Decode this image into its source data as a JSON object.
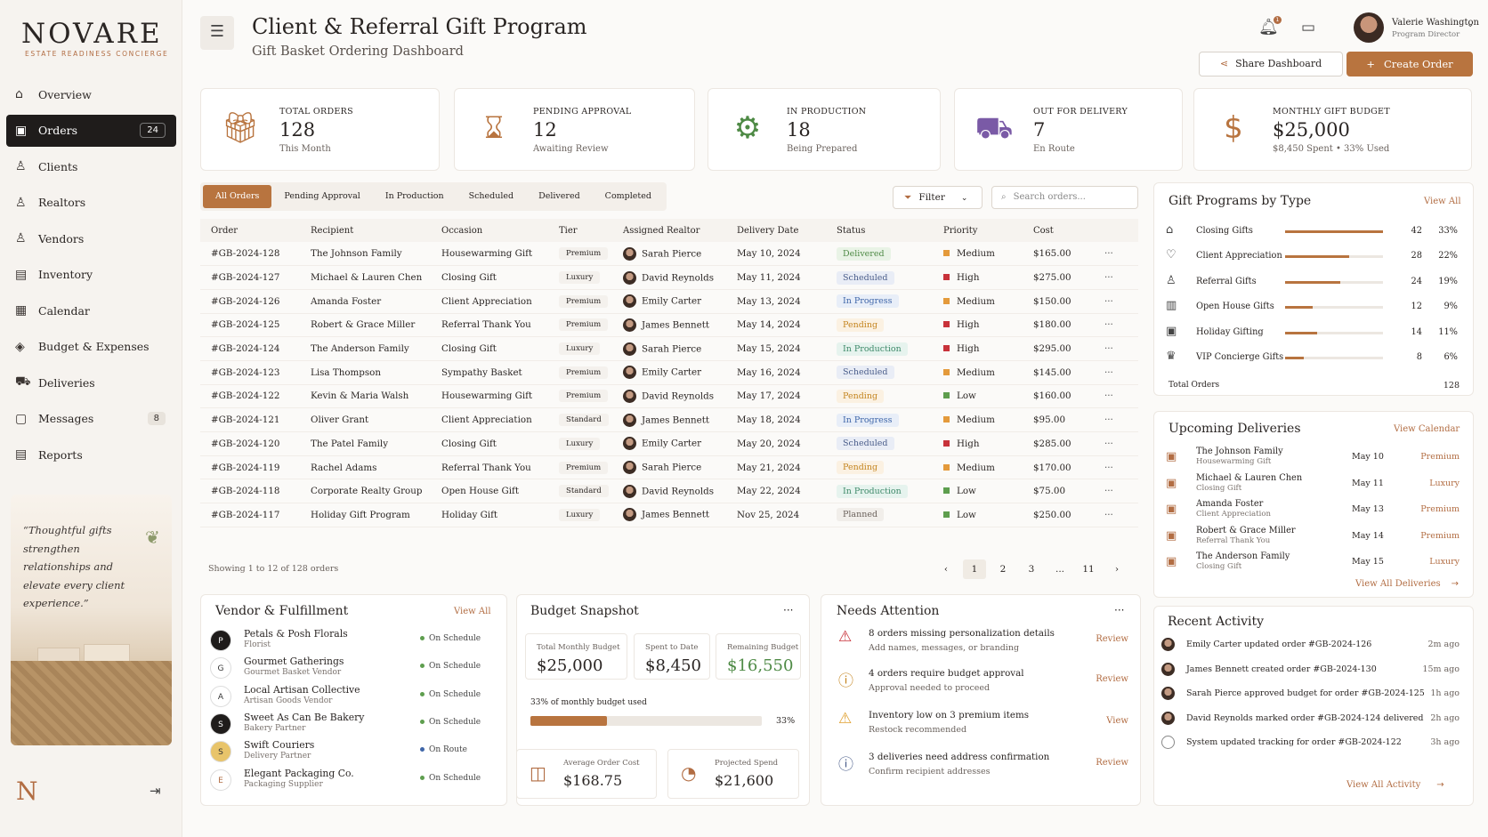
{
  "brand": {
    "logo": "NOVARE",
    "tagline": "ESTATE READINESS CONCIERGE",
    "mark": "N"
  },
  "nav": [
    {
      "label": "Overview",
      "icon": "home-icon",
      "glyph": "⌂"
    },
    {
      "label": "Orders",
      "icon": "gift-icon",
      "glyph": "▣",
      "badge": "24"
    },
    {
      "label": "Clients",
      "icon": "user-icon",
      "glyph": "♙"
    },
    {
      "label": "Realtors",
      "icon": "users-icon",
      "glyph": "♙"
    },
    {
      "label": "Vendors",
      "icon": "vendors-icon",
      "glyph": "♙"
    },
    {
      "label": "Inventory",
      "icon": "inventory-icon",
      "glyph": "▤"
    },
    {
      "label": "Calendar",
      "icon": "calendar-icon",
      "glyph": "▦"
    },
    {
      "label": "Budget & Expenses",
      "icon": "budget-icon",
      "glyph": "◈"
    },
    {
      "label": "Deliveries",
      "icon": "truck-icon",
      "glyph": "⛟"
    },
    {
      "label": "Messages",
      "icon": "message-icon",
      "glyph": "▢",
      "badge": "8"
    },
    {
      "label": "Reports",
      "icon": "report-icon",
      "glyph": "▤"
    }
  ],
  "quote": "“Thoughtful gifts strengthen relationships and elevate every client experience.”",
  "header": {
    "title": "Client & Referral Gift Program",
    "subtitle": "Gift Basket Ordering Dashboard",
    "notif_count": "1",
    "user_name": "Valerie Washington",
    "user_role": "Program Director",
    "share": "Share Dashboard",
    "create": "Create Order"
  },
  "stats": [
    {
      "label": "TOTAL ORDERS",
      "value": "128",
      "sub": "This Month",
      "icon": "gift-icon",
      "glyph": "🎁︎",
      "color": "#b8743f"
    },
    {
      "label": "PENDING APPROVAL",
      "value": "12",
      "sub": "Awaiting Review",
      "icon": "hourglass-icon",
      "glyph": "⌛︎",
      "color": "#b8743f"
    },
    {
      "label": "IN PRODUCTION",
      "value": "18",
      "sub": "Being Prepared",
      "icon": "gear-icon",
      "glyph": "⚙",
      "color": "#4e8a45"
    },
    {
      "label": "OUT FOR DELIVERY",
      "value": "7",
      "sub": "En Route",
      "icon": "truck-icon",
      "glyph": "⛟",
      "color": "#7a5aa6"
    },
    {
      "label": "MONTHLY GIFT BUDGET",
      "value": "$25,000",
      "sub": "$8,450 Spent • 33% Used",
      "icon": "dollar-icon",
      "glyph": "$",
      "color": "#b8743f"
    }
  ],
  "tabs": [
    "All Orders",
    "Pending Approval",
    "In Production",
    "Scheduled",
    "Delivered",
    "Completed"
  ],
  "filter": "Filter",
  "search_placeholder": "Search orders...",
  "columns": [
    "Order",
    "Recipient",
    "Occasion",
    "Tier",
    "Assigned Realtor",
    "Delivery Date",
    "Status",
    "Priority",
    "Cost"
  ],
  "orders": [
    {
      "id": "#GB-2024-128",
      "recipient": "The Johnson Family",
      "occasion": "Housewarming Gift",
      "tier": "Premium",
      "realtor": "Sarah Pierce",
      "date": "May 10, 2024",
      "status": "Delivered",
      "priority": "Medium",
      "cost": "$165.00"
    },
    {
      "id": "#GB-2024-127",
      "recipient": "Michael & Lauren Chen",
      "occasion": "Closing Gift",
      "tier": "Luxury",
      "realtor": "David Reynolds",
      "date": "May 11, 2024",
      "status": "Scheduled",
      "priority": "High",
      "cost": "$275.00"
    },
    {
      "id": "#GB-2024-126",
      "recipient": "Amanda Foster",
      "occasion": "Client Appreciation",
      "tier": "Premium",
      "realtor": "Emily Carter",
      "date": "May 13, 2024",
      "status": "In Progress",
      "priority": "Medium",
      "cost": "$150.00"
    },
    {
      "id": "#GB-2024-125",
      "recipient": "Robert & Grace Miller",
      "occasion": "Referral Thank You",
      "tier": "Premium",
      "realtor": "James Bennett",
      "date": "May 14, 2024",
      "status": "Pending",
      "priority": "High",
      "cost": "$180.00"
    },
    {
      "id": "#GB-2024-124",
      "recipient": "The Anderson Family",
      "occasion": "Closing Gift",
      "tier": "Luxury",
      "realtor": "Sarah Pierce",
      "date": "May 15, 2024",
      "status": "In Production",
      "priority": "High",
      "cost": "$295.00"
    },
    {
      "id": "#GB-2024-123",
      "recipient": "Lisa Thompson",
      "occasion": "Sympathy Basket",
      "tier": "Premium",
      "realtor": "Emily Carter",
      "date": "May 16, 2024",
      "status": "Scheduled",
      "priority": "Medium",
      "cost": "$145.00"
    },
    {
      "id": "#GB-2024-122",
      "recipient": "Kevin & Maria Walsh",
      "occasion": "Housewarming Gift",
      "tier": "Premium",
      "realtor": "David Reynolds",
      "date": "May 17, 2024",
      "status": "Pending",
      "priority": "Low",
      "cost": "$160.00"
    },
    {
      "id": "#GB-2024-121",
      "recipient": "Oliver Grant",
      "occasion": "Client Appreciation",
      "tier": "Standard",
      "realtor": "James Bennett",
      "date": "May 18, 2024",
      "status": "In Progress",
      "priority": "Medium",
      "cost": "$95.00"
    },
    {
      "id": "#GB-2024-120",
      "recipient": "The Patel Family",
      "occasion": "Closing Gift",
      "tier": "Luxury",
      "realtor": "Emily Carter",
      "date": "May 20, 2024",
      "status": "Scheduled",
      "priority": "High",
      "cost": "$285.00"
    },
    {
      "id": "#GB-2024-119",
      "recipient": "Rachel Adams",
      "occasion": "Referral Thank You",
      "tier": "Premium",
      "realtor": "Sarah Pierce",
      "date": "May 21, 2024",
      "status": "Pending",
      "priority": "Medium",
      "cost": "$170.00"
    },
    {
      "id": "#GB-2024-118",
      "recipient": "Corporate Realty Group",
      "occasion": "Open House Gift",
      "tier": "Standard",
      "realtor": "David Reynolds",
      "date": "May 22, 2024",
      "status": "In Production",
      "priority": "Low",
      "cost": "$75.00"
    },
    {
      "id": "#GB-2024-117",
      "recipient": "Holiday Gift Program",
      "occasion": "Holiday Gift",
      "tier": "Luxury",
      "realtor": "James Bennett",
      "date": "Nov 25, 2024",
      "status": "Planned",
      "priority": "Low",
      "cost": "$250.00"
    }
  ],
  "showing": "Showing 1 to 12 of 128 orders",
  "pager": [
    "‹",
    "1",
    "2",
    "3",
    "...",
    "11",
    "›"
  ],
  "gift_programs": {
    "title": "Gift Programs by Type",
    "link": "View All",
    "total_label": "Total Orders",
    "total": "128",
    "rows": [
      {
        "label": "Closing Gifts",
        "count": "42",
        "pct": "33%",
        "share": 1.0,
        "icon": "home-icon",
        "glyph": "⌂"
      },
      {
        "label": "Client Appreciation",
        "count": "28",
        "pct": "22%",
        "share": 0.65,
        "icon": "heart-icon",
        "glyph": "♡"
      },
      {
        "label": "Referral Gifts",
        "count": "24",
        "pct": "19%",
        "share": 0.56,
        "icon": "users-icon",
        "glyph": "♙"
      },
      {
        "label": "Open House Gifts",
        "count": "12",
        "pct": "9%",
        "share": 0.28,
        "icon": "building-icon",
        "glyph": "▥"
      },
      {
        "label": "Holiday Gifting",
        "count": "14",
        "pct": "11%",
        "share": 0.33,
        "icon": "gift-icon",
        "glyph": "▣"
      },
      {
        "label": "VIP Concierge Gifts",
        "count": "8",
        "pct": "6%",
        "share": 0.19,
        "icon": "crown-icon",
        "glyph": "♛"
      }
    ]
  },
  "upcoming": {
    "title": "Upcoming Deliveries",
    "link": "View Calendar",
    "footer": "View All Deliveries",
    "rows": [
      {
        "name": "The Johnson Family",
        "occasion": "Housewarming Gift",
        "date": "May 10",
        "tier": "Premium"
      },
      {
        "name": "Michael & Lauren Chen",
        "occasion": "Closing Gift",
        "date": "May 11",
        "tier": "Luxury"
      },
      {
        "name": "Amanda Foster",
        "occasion": "Client Appreciation",
        "date": "May 13",
        "tier": "Premium"
      },
      {
        "name": "Robert & Grace Miller",
        "occasion": "Referral Thank You",
        "date": "May 14",
        "tier": "Premium"
      },
      {
        "name": "The Anderson Family",
        "occasion": "Closing Gift",
        "date": "May 15",
        "tier": "Luxury"
      }
    ]
  },
  "vendors": {
    "title": "Vendor & Fulfillment",
    "link": "View All",
    "rows": [
      {
        "name": "Petals & Posh Florals",
        "type": "Florist",
        "status": "On Schedule",
        "dot": "#5e9e4e",
        "logo": "P",
        "logo_bg": "#1f1c1b",
        "logo_fg": "#fff"
      },
      {
        "name": "Gourmet Gatherings",
        "type": "Gourmet Basket Vendor",
        "status": "On Schedule",
        "dot": "#5e9e4e",
        "logo": "G",
        "logo_bg": "#fff",
        "logo_fg": "#333"
      },
      {
        "name": "Local Artisan Collective",
        "type": "Artisan Goods Vendor",
        "status": "On Schedule",
        "dot": "#5e9e4e",
        "logo": "A",
        "logo_bg": "#fff",
        "logo_fg": "#333"
      },
      {
        "name": "Sweet As Can Be Bakery",
        "type": "Bakery Partner",
        "status": "On Schedule",
        "dot": "#5e9e4e",
        "logo": "S",
        "logo_bg": "#1f1c1b",
        "logo_fg": "#fff"
      },
      {
        "name": "Swift Couriers",
        "type": "Delivery Partner",
        "status": "On Route",
        "dot": "#3f66a8",
        "logo": "S",
        "logo_bg": "#e8c46a",
        "logo_fg": "#333"
      },
      {
        "name": "Elegant Packaging Co.",
        "type": "Packaging Supplier",
        "status": "On Schedule",
        "dot": "#5e9e4e",
        "logo": "E",
        "logo_bg": "#fff",
        "logo_fg": "#b26d43"
      }
    ]
  },
  "budget": {
    "title": "Budget Snapshot",
    "total_label": "Total Monthly Budget",
    "total": "$25,000",
    "spent_label": "Spent to Date",
    "spent": "$8,450",
    "remaining_label": "Remaining Budget",
    "remaining": "$16,550",
    "used_text": "33% of monthly budget used",
    "used_pct": "33%",
    "used_frac": 0.33,
    "avg_label": "Average Order Cost",
    "avg": "$168.75",
    "proj_label": "Projected Spend",
    "proj": "$21,600",
    "remaining_color": "#4e8a45"
  },
  "attention": {
    "title": "Needs Attention",
    "rows": [
      {
        "title": "8 orders missing personalization details",
        "sub": "Add names, messages, or branding",
        "action": "Review",
        "icon": "warning-icon",
        "glyph": "⚠",
        "color": "#c8323a"
      },
      {
        "title": "4 orders require budget approval",
        "sub": "Approval needed to proceed",
        "action": "Review",
        "icon": "alert-icon",
        "glyph": "ⓘ",
        "color": "#c4841e"
      },
      {
        "title": "Inventory low on 3 premium items",
        "sub": "Restock recommended",
        "action": "View",
        "icon": "warning-icon",
        "glyph": "⚠",
        "color": "#e0a030"
      },
      {
        "title": "3 deliveries need address confirmation",
        "sub": "Confirm recipient addresses",
        "action": "Review",
        "icon": "info-icon",
        "glyph": "ⓘ",
        "color": "#4a5d8a"
      }
    ]
  },
  "activity": {
    "title": "Recent Activity",
    "footer": "View All Activity",
    "rows": [
      {
        "text": "Emily Carter updated order #GB-2024-126",
        "time": "2m ago"
      },
      {
        "text": "James Bennett created order #GB-2024-130",
        "time": "15m ago"
      },
      {
        "text": "Sarah Pierce approved budget for order #GB-2024-125",
        "time": "1h ago"
      },
      {
        "text": "David Reynolds marked order #GB-2024-124 delivered",
        "time": "2h ago"
      },
      {
        "text": "System updated tracking for order #GB-2024-122",
        "time": "3h ago"
      }
    ]
  }
}
